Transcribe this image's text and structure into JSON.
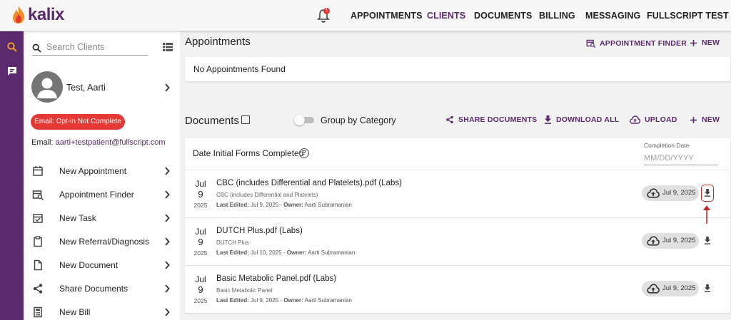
{
  "topbar": {
    "logo": "kalix",
    "notification_count": "1",
    "nav": [
      "APPOINTMENTS",
      "CLIENTS",
      "DOCUMENTS",
      "BILLING",
      "MESSAGING",
      "FULLSCRIPT TEST"
    ],
    "active_nav": "CLIENTS"
  },
  "sidebar": {
    "search_placeholder": "Search Clients",
    "patient_name": "Test, Aarti",
    "optin_badge": "Email: Opt-in Not Complete",
    "email_label": "Email:",
    "email_value": "aarti+testpatient@fullscript.com",
    "menu": [
      {
        "label": "New Appointment",
        "icon": "calendar-icon"
      },
      {
        "label": "Appointment Finder",
        "icon": "calendar-search-icon"
      },
      {
        "label": "New Task",
        "icon": "calendar-check-icon"
      },
      {
        "label": "New Referral/Diagnosis",
        "icon": "clipboard-icon"
      },
      {
        "label": "New Document",
        "icon": "document-icon"
      },
      {
        "label": "Share Documents",
        "icon": "share-icon"
      },
      {
        "label": "New Bill",
        "icon": "calculator-icon"
      }
    ]
  },
  "appointments": {
    "title": "Appointments",
    "finder_label": "APPOINTMENT FINDER",
    "new_label": "NEW",
    "empty_text": "No Appointments Found"
  },
  "documents": {
    "title": "Documents",
    "group_label": "Group by Category",
    "share_label": "SHARE DOCUMENTS",
    "download_all_label": "DOWNLOAD ALL",
    "upload_label": "UPLOAD",
    "new_label": "NEW",
    "initial_forms_label": "Date Initial Forms Completed",
    "help_glyph": "?",
    "completion_date_label": "Completion Date",
    "completion_date_placeholder": "MM/DD/YYYY",
    "meta_last_edited": "Last Edited:",
    "meta_owner": "Owner:",
    "rows": [
      {
        "month": "Jul",
        "day": "9",
        "year": "2025",
        "title": "CBC (includes Differential and Platelets).pdf (Labs)",
        "subtitle": "CBC (includes Differential and Platelets)",
        "last_edited": "Jul 9, 2025",
        "owner": "Aarti Subramanian",
        "uploaded": "Jul 9, 2025"
      },
      {
        "month": "Jul",
        "day": "9",
        "year": "2025",
        "title": "DUTCH Plus.pdf (Labs)",
        "subtitle": "DUTCH Plus",
        "last_edited": "Jul 10, 2025",
        "owner": "Aarti Subramanian",
        "uploaded": "Jul 9, 2025"
      },
      {
        "month": "Jul",
        "day": "9",
        "year": "2025",
        "title": "Basic Metabolic Panel.pdf (Labs)",
        "subtitle": "Basic Metabolic Panel",
        "last_edited": "Jul 9, 2025",
        "owner": "Aarti Subramanian",
        "uploaded": "Jul 9, 2025"
      }
    ]
  },
  "colors": {
    "brand": "#5b2a6e",
    "alert": "#e53935",
    "highlight": "#c62828"
  }
}
